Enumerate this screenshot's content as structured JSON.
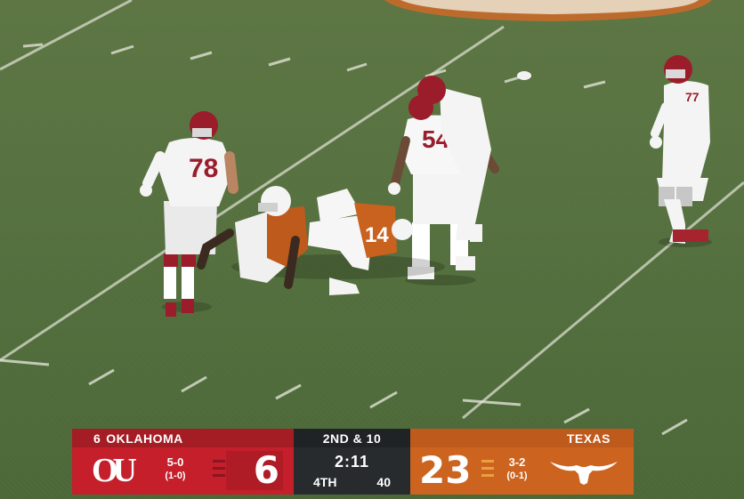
{
  "scoreboard": {
    "away": {
      "rank": "6",
      "name": "OKLAHOMA",
      "score": "6",
      "record": "5-0",
      "conference_record": "(1-0)",
      "logo": "ou-logo",
      "primary_color": "#c41f2a"
    },
    "home": {
      "name": "TEXAS",
      "score": "23",
      "record": "3-2",
      "conference_record": "(0-1)",
      "logo": "longhorn-logo",
      "primary_color": "#cc6420"
    },
    "down_distance": "2ND & 10",
    "clock": "2:11",
    "quarter": "4TH",
    "play_clock": "40"
  },
  "players": [
    {
      "team": "Oklahoma",
      "number": "78",
      "color": "#ffffff"
    },
    {
      "team": "Oklahoma",
      "number": "54",
      "color": "#ffffff"
    },
    {
      "team": "Oklahoma",
      "number": "77",
      "color": "#ffffff"
    },
    {
      "team": "Texas",
      "number": "14",
      "color": "#cc6420"
    }
  ],
  "logo_text": {
    "ou": "OU"
  }
}
